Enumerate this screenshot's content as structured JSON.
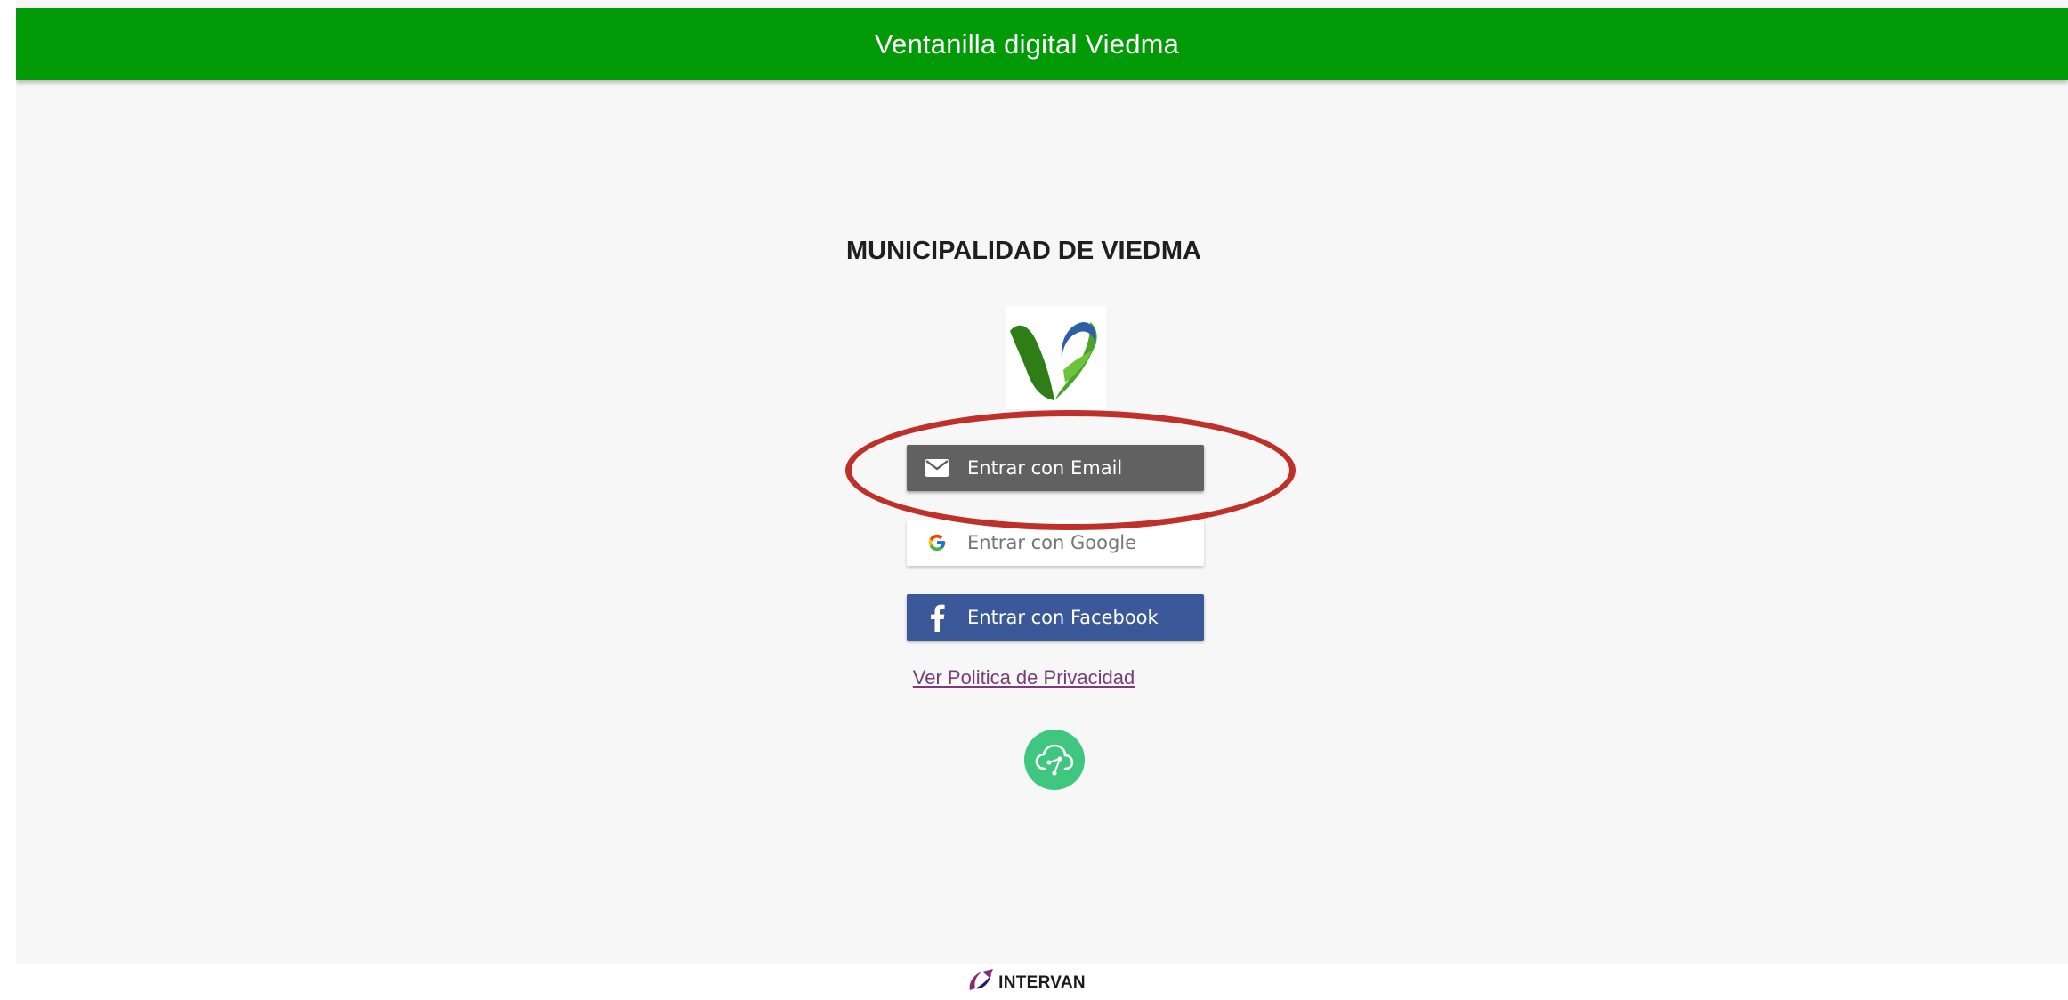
{
  "header": {
    "title": "Ventanilla digital Viedma"
  },
  "main": {
    "org_title": "MUNICIPALIDAD DE VIEDMA",
    "logo_icon": "viedma-v-logo",
    "buttons": {
      "email": {
        "label": "Entrar con Email",
        "icon": "mail-icon",
        "color": "#616161"
      },
      "google": {
        "label": "Entrar con Google",
        "icon": "google-icon",
        "color": "#ffffff"
      },
      "facebook": {
        "label": "Entrar con Facebook",
        "icon": "facebook-icon",
        "color": "#3b5998"
      }
    },
    "privacy_link": "Ver Politica de Privacidad",
    "cloud_icon": "cloud-icon"
  },
  "footer": {
    "brand": "INTERVAN",
    "icon": "intervan-logo-icon"
  },
  "colors": {
    "header_bg": "#039a07",
    "highlight": "#c0302a",
    "cloud_badge": "#3fc67f",
    "link": "#7a3b7a"
  }
}
